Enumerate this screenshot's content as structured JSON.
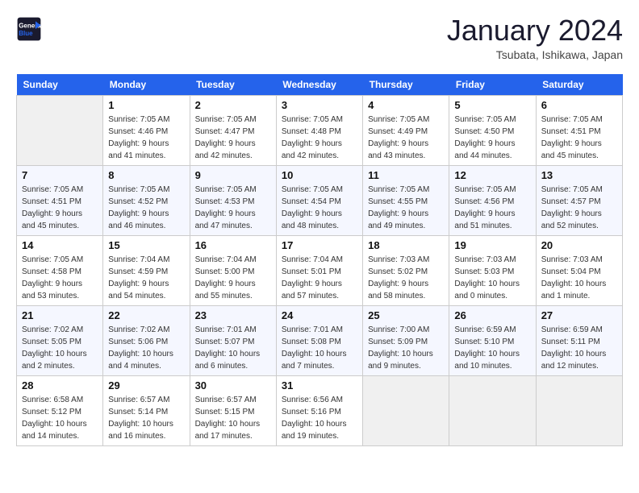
{
  "header": {
    "logo_general": "General",
    "logo_blue": "Blue",
    "month": "January 2024",
    "location": "Tsubata, Ishikawa, Japan"
  },
  "days_of_week": [
    "Sunday",
    "Monday",
    "Tuesday",
    "Wednesday",
    "Thursday",
    "Friday",
    "Saturday"
  ],
  "weeks": [
    [
      {
        "day": null,
        "data": null
      },
      {
        "day": "1",
        "data": "Sunrise: 7:05 AM\nSunset: 4:46 PM\nDaylight: 9 hours\nand 41 minutes."
      },
      {
        "day": "2",
        "data": "Sunrise: 7:05 AM\nSunset: 4:47 PM\nDaylight: 9 hours\nand 42 minutes."
      },
      {
        "day": "3",
        "data": "Sunrise: 7:05 AM\nSunset: 4:48 PM\nDaylight: 9 hours\nand 42 minutes."
      },
      {
        "day": "4",
        "data": "Sunrise: 7:05 AM\nSunset: 4:49 PM\nDaylight: 9 hours\nand 43 minutes."
      },
      {
        "day": "5",
        "data": "Sunrise: 7:05 AM\nSunset: 4:50 PM\nDaylight: 9 hours\nand 44 minutes."
      },
      {
        "day": "6",
        "data": "Sunrise: 7:05 AM\nSunset: 4:51 PM\nDaylight: 9 hours\nand 45 minutes."
      }
    ],
    [
      {
        "day": "7",
        "data": "Sunrise: 7:05 AM\nSunset: 4:51 PM\nDaylight: 9 hours\nand 45 minutes."
      },
      {
        "day": "8",
        "data": "Sunrise: 7:05 AM\nSunset: 4:52 PM\nDaylight: 9 hours\nand 46 minutes."
      },
      {
        "day": "9",
        "data": "Sunrise: 7:05 AM\nSunset: 4:53 PM\nDaylight: 9 hours\nand 47 minutes."
      },
      {
        "day": "10",
        "data": "Sunrise: 7:05 AM\nSunset: 4:54 PM\nDaylight: 9 hours\nand 48 minutes."
      },
      {
        "day": "11",
        "data": "Sunrise: 7:05 AM\nSunset: 4:55 PM\nDaylight: 9 hours\nand 49 minutes."
      },
      {
        "day": "12",
        "data": "Sunrise: 7:05 AM\nSunset: 4:56 PM\nDaylight: 9 hours\nand 51 minutes."
      },
      {
        "day": "13",
        "data": "Sunrise: 7:05 AM\nSunset: 4:57 PM\nDaylight: 9 hours\nand 52 minutes."
      }
    ],
    [
      {
        "day": "14",
        "data": "Sunrise: 7:05 AM\nSunset: 4:58 PM\nDaylight: 9 hours\nand 53 minutes."
      },
      {
        "day": "15",
        "data": "Sunrise: 7:04 AM\nSunset: 4:59 PM\nDaylight: 9 hours\nand 54 minutes."
      },
      {
        "day": "16",
        "data": "Sunrise: 7:04 AM\nSunset: 5:00 PM\nDaylight: 9 hours\nand 55 minutes."
      },
      {
        "day": "17",
        "data": "Sunrise: 7:04 AM\nSunset: 5:01 PM\nDaylight: 9 hours\nand 57 minutes."
      },
      {
        "day": "18",
        "data": "Sunrise: 7:03 AM\nSunset: 5:02 PM\nDaylight: 9 hours\nand 58 minutes."
      },
      {
        "day": "19",
        "data": "Sunrise: 7:03 AM\nSunset: 5:03 PM\nDaylight: 10 hours\nand 0 minutes."
      },
      {
        "day": "20",
        "data": "Sunrise: 7:03 AM\nSunset: 5:04 PM\nDaylight: 10 hours\nand 1 minute."
      }
    ],
    [
      {
        "day": "21",
        "data": "Sunrise: 7:02 AM\nSunset: 5:05 PM\nDaylight: 10 hours\nand 2 minutes."
      },
      {
        "day": "22",
        "data": "Sunrise: 7:02 AM\nSunset: 5:06 PM\nDaylight: 10 hours\nand 4 minutes."
      },
      {
        "day": "23",
        "data": "Sunrise: 7:01 AM\nSunset: 5:07 PM\nDaylight: 10 hours\nand 6 minutes."
      },
      {
        "day": "24",
        "data": "Sunrise: 7:01 AM\nSunset: 5:08 PM\nDaylight: 10 hours\nand 7 minutes."
      },
      {
        "day": "25",
        "data": "Sunrise: 7:00 AM\nSunset: 5:09 PM\nDaylight: 10 hours\nand 9 minutes."
      },
      {
        "day": "26",
        "data": "Sunrise: 6:59 AM\nSunset: 5:10 PM\nDaylight: 10 hours\nand 10 minutes."
      },
      {
        "day": "27",
        "data": "Sunrise: 6:59 AM\nSunset: 5:11 PM\nDaylight: 10 hours\nand 12 minutes."
      }
    ],
    [
      {
        "day": "28",
        "data": "Sunrise: 6:58 AM\nSunset: 5:12 PM\nDaylight: 10 hours\nand 14 minutes."
      },
      {
        "day": "29",
        "data": "Sunrise: 6:57 AM\nSunset: 5:14 PM\nDaylight: 10 hours\nand 16 minutes."
      },
      {
        "day": "30",
        "data": "Sunrise: 6:57 AM\nSunset: 5:15 PM\nDaylight: 10 hours\nand 17 minutes."
      },
      {
        "day": "31",
        "data": "Sunrise: 6:56 AM\nSunset: 5:16 PM\nDaylight: 10 hours\nand 19 minutes."
      },
      {
        "day": null,
        "data": null
      },
      {
        "day": null,
        "data": null
      },
      {
        "day": null,
        "data": null
      }
    ]
  ]
}
